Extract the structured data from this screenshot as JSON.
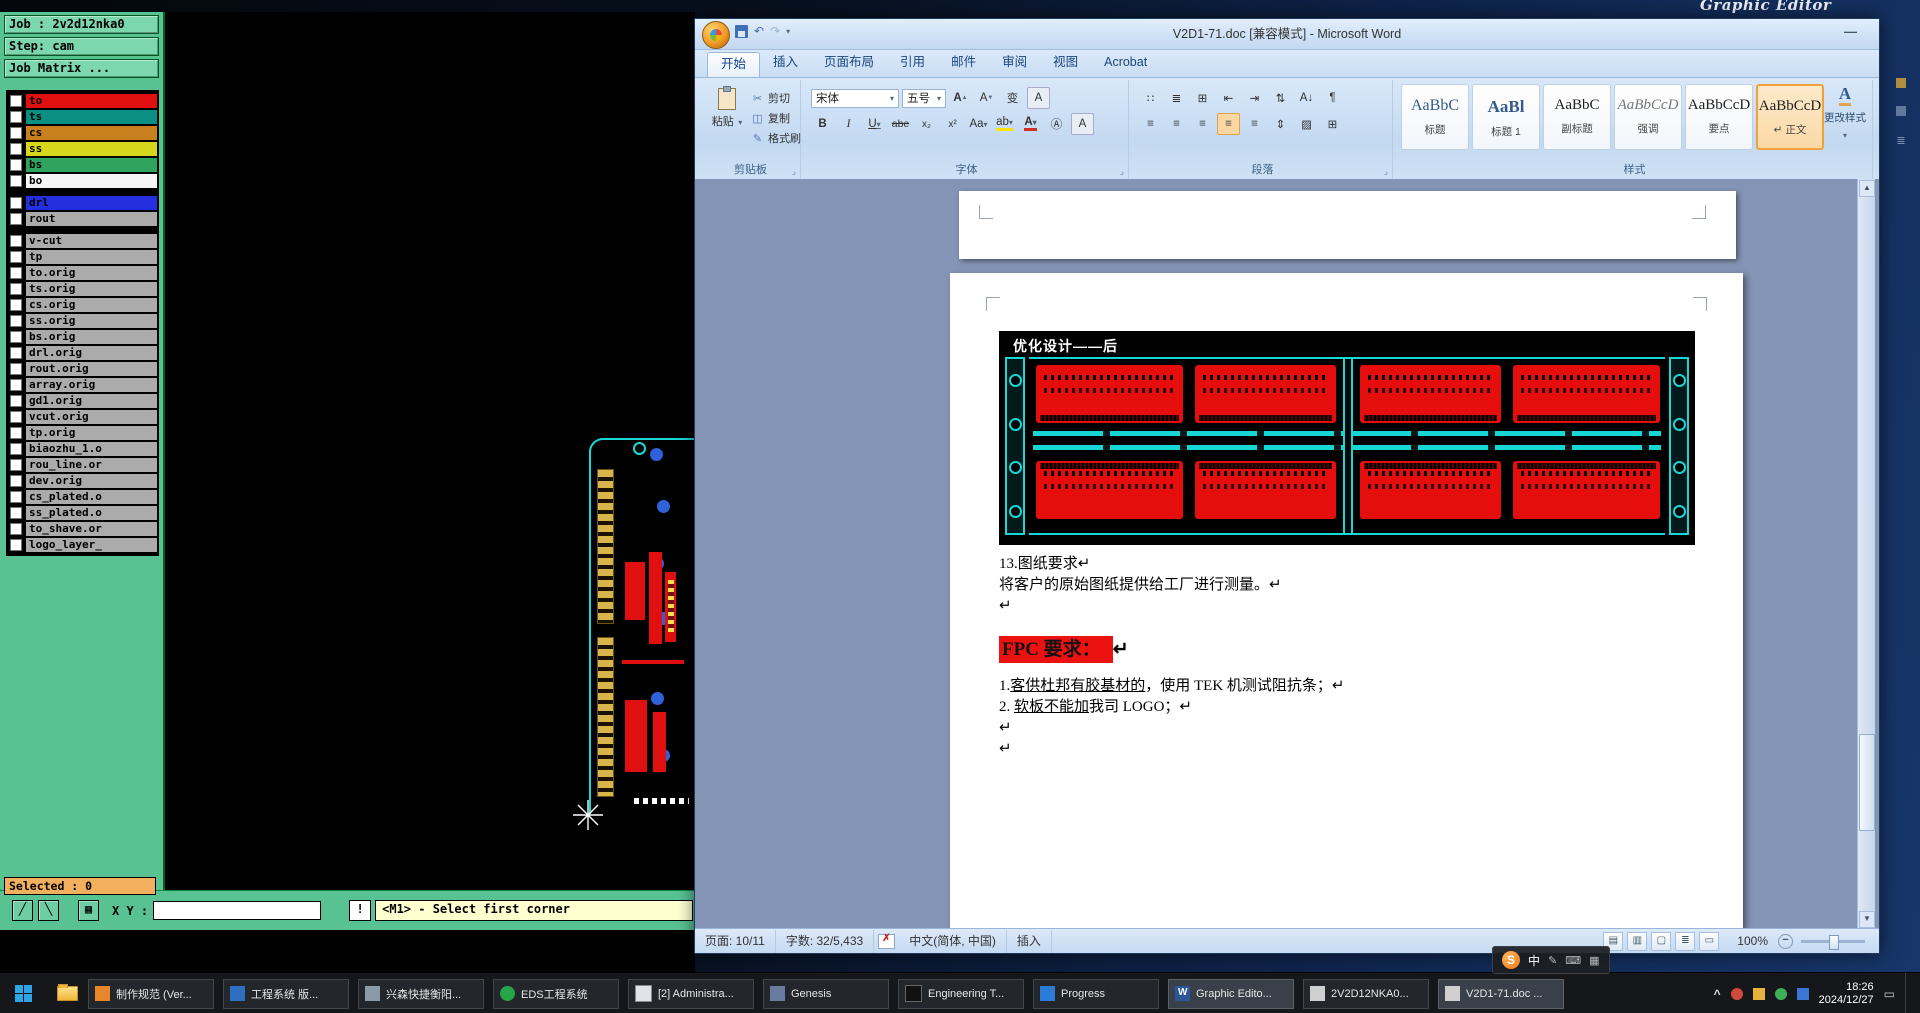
{
  "ui": {
    "caret": "▾",
    "launcher": "⌟",
    "min": "—",
    "caret_up": "^",
    "up_arrow": "▲",
    "down_arrow": "▼",
    "zoom_minus": "−"
  },
  "desktop": {
    "bg_title": "Graphic Editor"
  },
  "cam": {
    "job": "Job : 2v2d12nka0",
    "step": "Step: cam",
    "matrix": "Job Matrix ...",
    "selected": "Selected : 0",
    "xy_label": "X Y :",
    "xy_value": "",
    "prompt": "!",
    "status": "<M1> - Select first corner",
    "icons": [
      "╱",
      "╲",
      "▦"
    ],
    "layers": [
      {
        "name": "to",
        "color": "#e01010"
      },
      {
        "name": "ts",
        "color": "#0b8f85"
      },
      {
        "name": "cs",
        "color": "#c8801e"
      },
      {
        "name": "ss",
        "color": "#d6d61c"
      },
      {
        "name": "bs",
        "color": "#2fa35f"
      },
      {
        "name": "bo",
        "color": "#f5f5f5"
      },
      {
        "name": "drl",
        "color": "#2430e0"
      },
      {
        "name": "rout",
        "color": "#ababab"
      },
      {
        "name": "v-cut",
        "color": "#ababab"
      },
      {
        "name": "tp",
        "color": "#ababab"
      },
      {
        "name": "to.orig",
        "color": "#ababab"
      },
      {
        "name": "ts.orig",
        "color": "#ababab"
      },
      {
        "name": "cs.orig",
        "color": "#ababab"
      },
      {
        "name": "ss.orig",
        "color": "#ababab"
      },
      {
        "name": "bs.orig",
        "color": "#ababab"
      },
      {
        "name": "drl.orig",
        "color": "#ababab"
      },
      {
        "name": "rout.orig",
        "color": "#ababab"
      },
      {
        "name": "array.orig",
        "color": "#ababab"
      },
      {
        "name": "gd1.orig",
        "color": "#ababab"
      },
      {
        "name": "vcut.orig",
        "color": "#ababab"
      },
      {
        "name": "tp.orig",
        "color": "#ababab"
      },
      {
        "name": "biaozhu_1.o",
        "color": "#ababab"
      },
      {
        "name": "rou_line.or",
        "color": "#ababab"
      },
      {
        "name": "dev.orig",
        "color": "#ababab"
      },
      {
        "name": "cs_plated.o",
        "color": "#ababab"
      },
      {
        "name": "ss_plated.o",
        "color": "#ababab"
      },
      {
        "name": "to_shave.or",
        "color": "#ababab"
      },
      {
        "name": "logo_layer_",
        "color": "#ababab"
      }
    ]
  },
  "word": {
    "title": "V2D1-71.doc [兼容模式] - Microsoft Word",
    "tabs": [
      "开始",
      "插入",
      "页面布局",
      "引用",
      "邮件",
      "审阅",
      "视图",
      "Acrobat"
    ],
    "ribbon": {
      "clipboard": {
        "group": "剪贴板",
        "paste": "粘贴",
        "cut": "剪切",
        "copy": "复制",
        "painter": "格式刷",
        "cut_icon": "✂",
        "copy_icon": "◫",
        "painter_icon": "✎"
      },
      "font": {
        "group": "字体",
        "family": "宋体",
        "size": "五号",
        "grow": "A",
        "shrink": "A",
        "pinyin": "变",
        "border_btn": "A",
        "bold": "B",
        "italic": "I",
        "underline": "U",
        "strike": "abe",
        "sub": "x₂",
        "sup": "x²",
        "case": "Aa",
        "highlight": "ab",
        "color": "A",
        "enclose": "Ⓐ",
        "shading": "A"
      },
      "paragraph": {
        "group": "段落",
        "r1": [
          "∷",
          "≣",
          "⊞",
          "⇤",
          "⇥",
          "⇅",
          "A↓",
          "¶"
        ],
        "r2": [
          "≡",
          "≡",
          "≡",
          "≡",
          "≡",
          "⇕",
          "▨",
          "⊞"
        ]
      },
      "styles": {
        "group": "样式",
        "change": "更改样式",
        "change_icon": "A",
        "items": [
          {
            "preview": "AaBbC",
            "label": "标题"
          },
          {
            "preview": "AaBl",
            "label": "标题 1"
          },
          {
            "preview": "AaBbC",
            "label": "副标题"
          },
          {
            "preview": "AaBbCcD",
            "label": "强调"
          },
          {
            "preview": "AaBbCcD",
            "label": "要点"
          },
          {
            "preview": "AaBbCcD",
            "label": "↵ 正文"
          }
        ]
      }
    },
    "doc": {
      "caption": "优化设计——后",
      "l1": "13.图纸要求↵",
      "l2": "将客户的原始图纸提供给工厂进行测量。↵",
      "l3": "↵",
      "fpc": "FPC 要求：",
      "fpc_mark": "↵",
      "i1a": "1.",
      "i1b": "客供杜邦有胶基材的",
      "i1c": "，使用 TEK 机测试阻抗条；↵",
      "i2a": "2. ",
      "i2b": "软板不能加",
      "i2c": "我司 LOGO；↵",
      "t1": "↵",
      "t2": "↵"
    },
    "status": {
      "page": "页面: 10/11",
      "words": "字数: 32/5,433",
      "lang": "中文(简体, 中国)",
      "insert": "插入",
      "zoom": "100%",
      "views": [
        "▤",
        "▥",
        "▢",
        "≣",
        "▭"
      ]
    }
  },
  "taskbar": {
    "items": [
      {
        "label": "制作规范 (Ver..."
      },
      {
        "label": "工程系统  版..."
      },
      {
        "label": "兴森快捷衡阳..."
      },
      {
        "label": "EDS工程系统"
      },
      {
        "label": "[2] Administra..."
      },
      {
        "label": "Genesis"
      },
      {
        "label": "Engineering T..."
      },
      {
        "label": "Progress"
      },
      {
        "label": "Graphic Edito..."
      },
      {
        "label": "2V2D12NKA0..."
      },
      {
        "label": "V2D1-71.doc ..."
      }
    ],
    "time": "18:26",
    "date": "2024/12/27",
    "sogou": {
      "logo": "S",
      "ime": "中",
      "tools": [
        "✎",
        "⌨",
        "▦"
      ]
    }
  }
}
